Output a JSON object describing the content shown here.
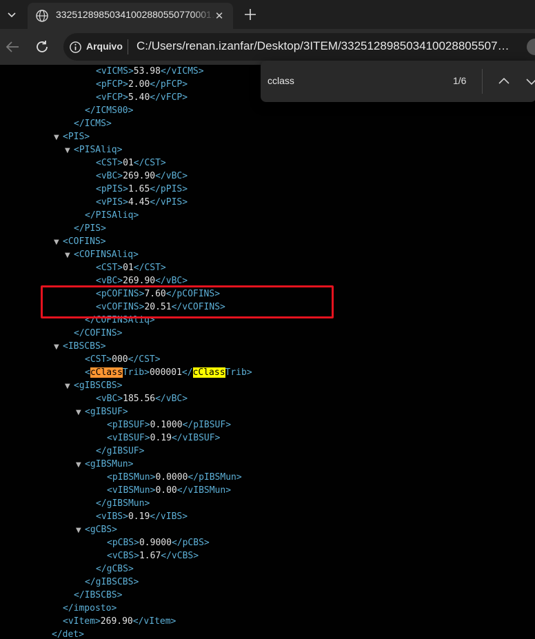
{
  "browser": {
    "tab_title": "33251289850341002880550770001…",
    "address_scheme": "Arquivo",
    "address_url": "C:/Users/renan.izanfar/Desktop/3ITEM/332512898503410028805507…"
  },
  "find": {
    "query": "cclass",
    "count": "1/6"
  },
  "xml_lines": [
    {
      "indent": 4,
      "tri": "",
      "tokens": [
        {
          "t": "<vICMS>",
          "c": "tg"
        },
        {
          "t": "53.98",
          "c": "v"
        },
        {
          "t": "</vICMS>",
          "c": "tg"
        }
      ]
    },
    {
      "indent": 4,
      "tri": "",
      "tokens": [
        {
          "t": "<pFCP>",
          "c": "tg"
        },
        {
          "t": "2.00",
          "c": "v"
        },
        {
          "t": "</pFCP>",
          "c": "tg"
        }
      ]
    },
    {
      "indent": 4,
      "tri": "",
      "tokens": [
        {
          "t": "<vFCP>",
          "c": "tg"
        },
        {
          "t": "5.40",
          "c": "v"
        },
        {
          "t": "</vFCP>",
          "c": "tg"
        }
      ]
    },
    {
      "indent": 3,
      "tri": "",
      "tokens": [
        {
          "t": "</ICMS00>",
          "c": "tg"
        }
      ]
    },
    {
      "indent": 2,
      "tri": "",
      "tokens": [
        {
          "t": "</ICMS>",
          "c": "tg"
        }
      ]
    },
    {
      "indent": 1,
      "tri": "▼",
      "tokens": [
        {
          "t": "<PIS>",
          "c": "tg"
        }
      ]
    },
    {
      "indent": 2,
      "tri": "▼",
      "tokens": [
        {
          "t": "<PISAliq>",
          "c": "tg"
        }
      ]
    },
    {
      "indent": 4,
      "tri": "",
      "tokens": [
        {
          "t": "<CST>",
          "c": "tg"
        },
        {
          "t": "01",
          "c": "v"
        },
        {
          "t": "</CST>",
          "c": "tg"
        }
      ]
    },
    {
      "indent": 4,
      "tri": "",
      "tokens": [
        {
          "t": "<vBC>",
          "c": "tg"
        },
        {
          "t": "269.90",
          "c": "v"
        },
        {
          "t": "</vBC>",
          "c": "tg"
        }
      ]
    },
    {
      "indent": 4,
      "tri": "",
      "tokens": [
        {
          "t": "<pPIS>",
          "c": "tg"
        },
        {
          "t": "1.65",
          "c": "v"
        },
        {
          "t": "</pPIS>",
          "c": "tg"
        }
      ]
    },
    {
      "indent": 4,
      "tri": "",
      "tokens": [
        {
          "t": "<vPIS>",
          "c": "tg"
        },
        {
          "t": "4.45",
          "c": "v"
        },
        {
          "t": "</vPIS>",
          "c": "tg"
        }
      ]
    },
    {
      "indent": 3,
      "tri": "",
      "tokens": [
        {
          "t": "</PISAliq>",
          "c": "tg"
        }
      ]
    },
    {
      "indent": 2,
      "tri": "",
      "tokens": [
        {
          "t": "</PIS>",
          "c": "tg"
        }
      ]
    },
    {
      "indent": 1,
      "tri": "▼",
      "tokens": [
        {
          "t": "<COFINS>",
          "c": "tg"
        }
      ]
    },
    {
      "indent": 2,
      "tri": "▼",
      "tokens": [
        {
          "t": "<COFINSAliq>",
          "c": "tg"
        }
      ]
    },
    {
      "indent": 4,
      "tri": "",
      "tokens": [
        {
          "t": "<CST>",
          "c": "tg"
        },
        {
          "t": "01",
          "c": "v"
        },
        {
          "t": "</CST>",
          "c": "tg"
        }
      ]
    },
    {
      "indent": 4,
      "tri": "",
      "tokens": [
        {
          "t": "<vBC>",
          "c": "tg"
        },
        {
          "t": "269.90",
          "c": "v"
        },
        {
          "t": "</vBC>",
          "c": "tg"
        }
      ]
    },
    {
      "indent": 4,
      "tri": "",
      "tokens": [
        {
          "t": "<pCOFINS>",
          "c": "tg"
        },
        {
          "t": "7.60",
          "c": "v"
        },
        {
          "t": "</pCOFINS>",
          "c": "tg"
        }
      ]
    },
    {
      "indent": 4,
      "tri": "",
      "tokens": [
        {
          "t": "<vCOFINS>",
          "c": "tg"
        },
        {
          "t": "20.51",
          "c": "v"
        },
        {
          "t": "</vCOFINS>",
          "c": "tg"
        }
      ]
    },
    {
      "indent": 3,
      "tri": "",
      "tokens": [
        {
          "t": "</COFINSAliq>",
          "c": "tg"
        }
      ]
    },
    {
      "indent": 2,
      "tri": "",
      "tokens": [
        {
          "t": "</COFINS>",
          "c": "tg"
        }
      ]
    },
    {
      "indent": 1,
      "tri": "▼",
      "tokens": [
        {
          "t": "<IBSCBS>",
          "c": "tg"
        }
      ]
    },
    {
      "indent": 3,
      "tri": "",
      "tokens": [
        {
          "t": "<CST>",
          "c": "tg"
        },
        {
          "t": "000",
          "c": "v"
        },
        {
          "t": "</CST>",
          "c": "tg"
        }
      ]
    },
    {
      "indent": 3,
      "tri": "",
      "tokens": [
        {
          "t": "<",
          "c": "tg"
        },
        {
          "t": "cClass",
          "c": "hl-cur"
        },
        {
          "t": "Trib>",
          "c": "tg"
        },
        {
          "t": "000001",
          "c": "v"
        },
        {
          "t": "</",
          "c": "tg"
        },
        {
          "t": "cClass",
          "c": "hl"
        },
        {
          "t": "Trib>",
          "c": "tg"
        }
      ]
    },
    {
      "indent": 2,
      "tri": "▼",
      "tokens": [
        {
          "t": "<gIBSCBS>",
          "c": "tg"
        }
      ]
    },
    {
      "indent": 4,
      "tri": "",
      "tokens": [
        {
          "t": "<vBC>",
          "c": "tg"
        },
        {
          "t": "185.56",
          "c": "v"
        },
        {
          "t": "</vBC>",
          "c": "tg"
        }
      ]
    },
    {
      "indent": 3,
      "tri": "▼",
      "tokens": [
        {
          "t": "<gIBSUF>",
          "c": "tg"
        }
      ]
    },
    {
      "indent": 5,
      "tri": "",
      "tokens": [
        {
          "t": "<pIBSUF>",
          "c": "tg"
        },
        {
          "t": "0.1000",
          "c": "v"
        },
        {
          "t": "</pIBSUF>",
          "c": "tg"
        }
      ]
    },
    {
      "indent": 5,
      "tri": "",
      "tokens": [
        {
          "t": "<vIBSUF>",
          "c": "tg"
        },
        {
          "t": "0.19",
          "c": "v"
        },
        {
          "t": "</vIBSUF>",
          "c": "tg"
        }
      ]
    },
    {
      "indent": 4,
      "tri": "",
      "tokens": [
        {
          "t": "</gIBSUF>",
          "c": "tg"
        }
      ]
    },
    {
      "indent": 3,
      "tri": "▼",
      "tokens": [
        {
          "t": "<gIBSMun>",
          "c": "tg"
        }
      ]
    },
    {
      "indent": 5,
      "tri": "",
      "tokens": [
        {
          "t": "<pIBSMun>",
          "c": "tg"
        },
        {
          "t": "0.0000",
          "c": "v"
        },
        {
          "t": "</pIBSMun>",
          "c": "tg"
        }
      ]
    },
    {
      "indent": 5,
      "tri": "",
      "tokens": [
        {
          "t": "<vIBSMun>",
          "c": "tg"
        },
        {
          "t": "0.00",
          "c": "v"
        },
        {
          "t": "</vIBSMun>",
          "c": "tg"
        }
      ]
    },
    {
      "indent": 4,
      "tri": "",
      "tokens": [
        {
          "t": "</gIBSMun>",
          "c": "tg"
        }
      ]
    },
    {
      "indent": 4,
      "tri": "",
      "tokens": [
        {
          "t": "<vIBS>",
          "c": "tg"
        },
        {
          "t": "0.19",
          "c": "v"
        },
        {
          "t": "</vIBS>",
          "c": "tg"
        }
      ]
    },
    {
      "indent": 3,
      "tri": "▼",
      "tokens": [
        {
          "t": "<gCBS>",
          "c": "tg"
        }
      ]
    },
    {
      "indent": 5,
      "tri": "",
      "tokens": [
        {
          "t": "<pCBS>",
          "c": "tg"
        },
        {
          "t": "0.9000",
          "c": "v"
        },
        {
          "t": "</pCBS>",
          "c": "tg"
        }
      ]
    },
    {
      "indent": 5,
      "tri": "",
      "tokens": [
        {
          "t": "<vCBS>",
          "c": "tg"
        },
        {
          "t": "1.67",
          "c": "v"
        },
        {
          "t": "</vCBS>",
          "c": "tg"
        }
      ]
    },
    {
      "indent": 4,
      "tri": "",
      "tokens": [
        {
          "t": "</gCBS>",
          "c": "tg"
        }
      ]
    },
    {
      "indent": 3,
      "tri": "",
      "tokens": [
        {
          "t": "</gIBSCBS>",
          "c": "tg"
        }
      ]
    },
    {
      "indent": 2,
      "tri": "",
      "tokens": [
        {
          "t": "</IBSCBS>",
          "c": "tg"
        }
      ]
    },
    {
      "indent": 1,
      "tri": "",
      "tokens": [
        {
          "t": "</imposto>",
          "c": "tg"
        }
      ]
    },
    {
      "indent": 1,
      "tri": "",
      "tokens": [
        {
          "t": "<vItem>",
          "c": "tg"
        },
        {
          "t": "269.90",
          "c": "v"
        },
        {
          "t": "</vItem>",
          "c": "tg"
        }
      ]
    },
    {
      "indent": 0,
      "tri": "",
      "tokens": [
        {
          "t": "</det>",
          "c": "tg"
        }
      ]
    }
  ],
  "colors": {
    "page_bg": "#010101",
    "tag": "#5db0d7",
    "text": "#e3e3e3",
    "highlight": "#ffff00",
    "highlight_current": "#ff9632",
    "annotation": "#e5121e"
  }
}
